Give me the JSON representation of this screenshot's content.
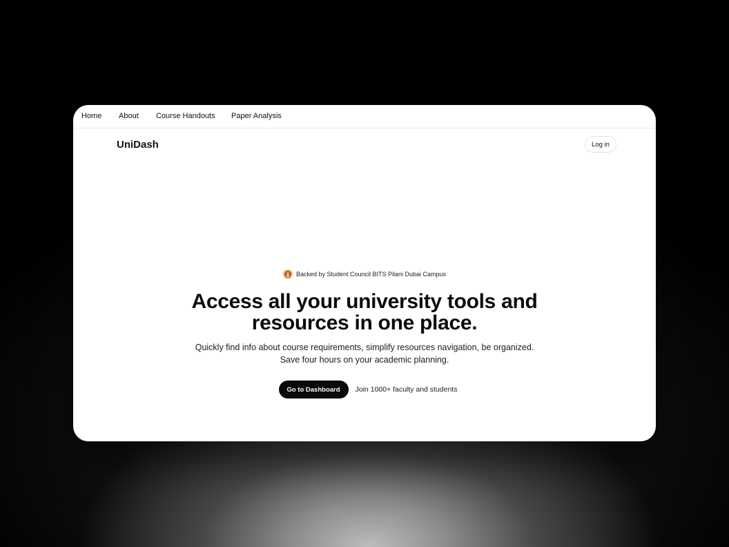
{
  "nav": {
    "items": [
      {
        "label": "Home"
      },
      {
        "label": "About"
      },
      {
        "label": "Course Handouts"
      },
      {
        "label": "Paper Analysis"
      }
    ]
  },
  "header": {
    "brand": "UniDash",
    "login_label": "Log in"
  },
  "hero": {
    "badge_text": "Backed by Student Council BITS Pilani Dubai Campus",
    "badge_icon": "council-logo-icon",
    "headline_lines": [
      "Access all your university tools and",
      "resources in one place."
    ],
    "subtext_lines": [
      "Quickly find info about course requirements, simplify resources navigation, be organized.",
      "Save four hours on your academic planning."
    ],
    "cta_label": "Go to Dashboard",
    "social_proof": "Join 1000+ faculty and students"
  },
  "colors": {
    "card_background": "#ffffff",
    "cta_background": "#0a0a0a",
    "page_background": "#000000"
  }
}
